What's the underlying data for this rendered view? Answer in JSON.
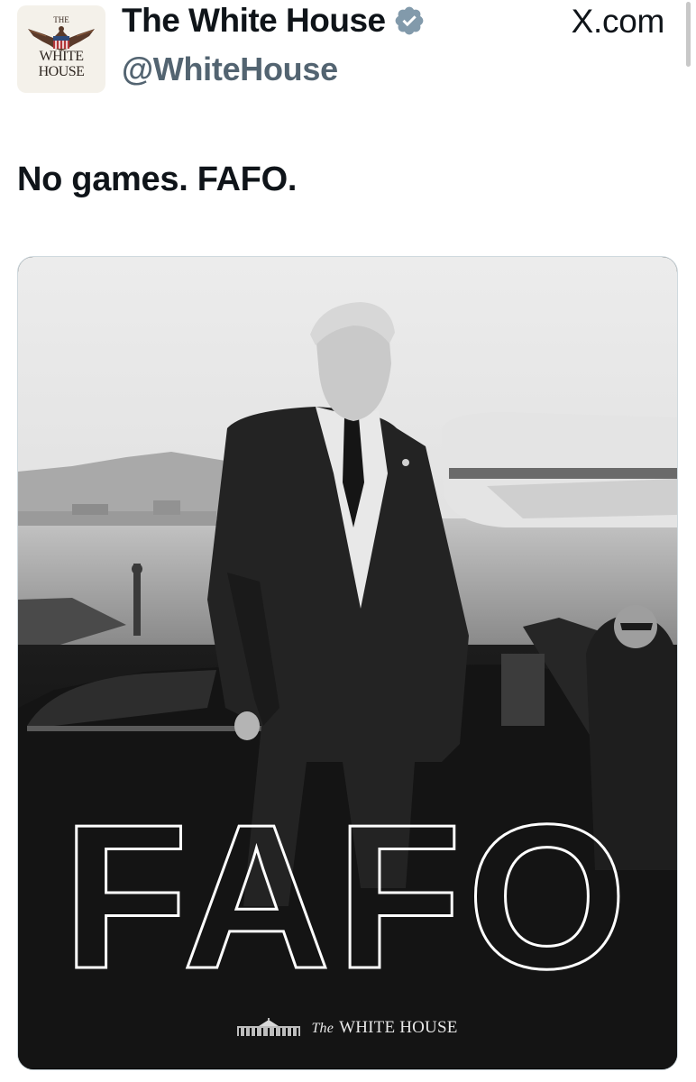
{
  "post": {
    "author": {
      "display_name": "The White House",
      "handle": "@WhiteHouse",
      "verified": true,
      "verified_color": "#829aab",
      "avatar": {
        "top_text": "THE",
        "line1": "WHITE",
        "line2": "HOUSE",
        "icon": "eagle-seal-icon"
      }
    },
    "site_label": "X.com",
    "text": "No games. FAFO.",
    "media": {
      "overlay_text": "FAFO",
      "watermark": {
        "icon": "white-house-building-icon",
        "prefix": "The",
        "name": "WHITE HOUSE"
      }
    }
  }
}
